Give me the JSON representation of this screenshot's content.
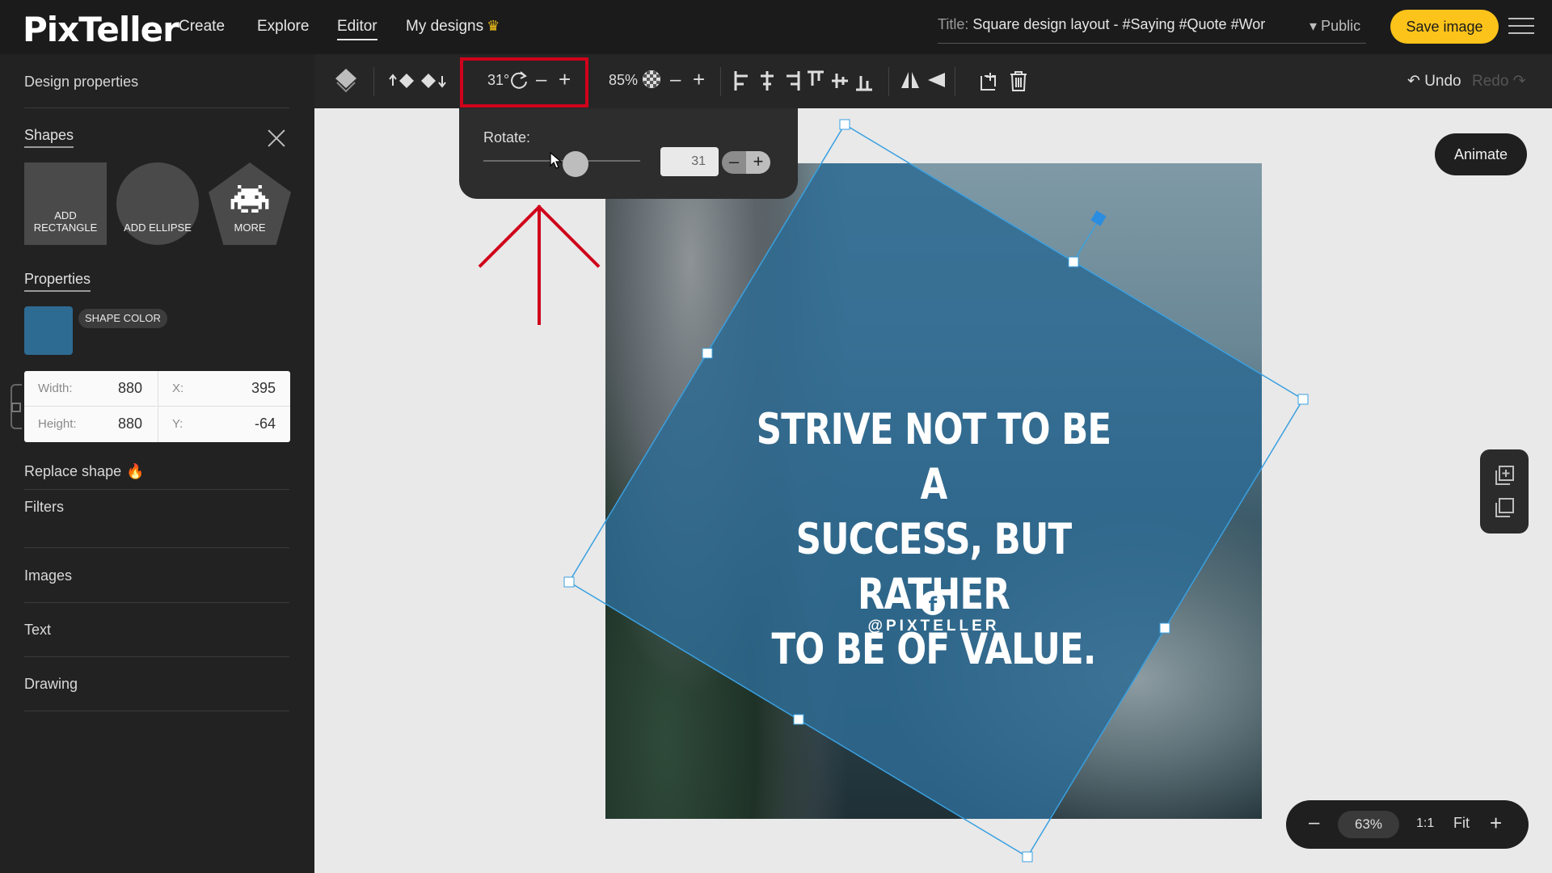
{
  "app": {
    "logo": "PixTeller",
    "nav": [
      "Create",
      "Explore",
      "Editor",
      "My designs"
    ],
    "title_label": "Title:",
    "title_value": "Square design layout - #Saying #Quote #Wor",
    "visibility": "Public",
    "save_label": "Save image"
  },
  "sidebar": {
    "design_properties": "Design properties",
    "shapes_heading": "Shapes",
    "shape_tiles": [
      "ADD RECTANGLE",
      "ADD ELLIPSE",
      "MORE"
    ],
    "properties_heading": "Properties",
    "shape_color_label": "SHAPE COLOR",
    "shape_color": "#2e6b93",
    "width_label": "Width:",
    "width_value": "880",
    "height_label": "Height:",
    "height_value": "880",
    "x_label": "X:",
    "x_value": "395",
    "y_label": "Y:",
    "y_value": "-64",
    "replace_shape": "Replace shape",
    "filters": "Filters",
    "images": "Images",
    "text": "Text",
    "drawing": "Drawing"
  },
  "toolbar": {
    "rotation": "31°",
    "opacity": "85%",
    "undo": "Undo",
    "redo": "Redo"
  },
  "rotate_popover": {
    "label": "Rotate:",
    "value": "31",
    "rotation_fraction": 0.086
  },
  "canvas": {
    "quote_lines": [
      "STRIVE NOT TO BE A",
      "SUCCESS, BUT RATHER",
      "TO BE OF VALUE."
    ],
    "handle": "@PIXTELLER",
    "animate": "Animate",
    "zoom": "63%",
    "ratio": "1:1",
    "fit": "Fit"
  }
}
